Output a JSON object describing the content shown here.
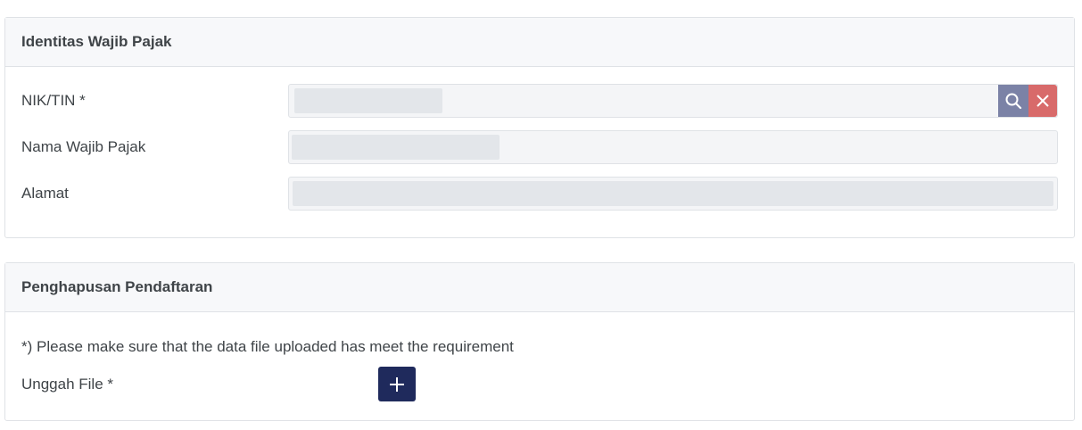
{
  "identity_section": {
    "title": "Identitas Wajib Pajak",
    "fields": {
      "nik": {
        "label": "NIK/TIN *"
      },
      "name": {
        "label": "Nama Wajib Pajak"
      },
      "address": {
        "label": "Alamat"
      }
    }
  },
  "removal_section": {
    "title": "Penghapusan Pendaftaran",
    "note": "*) Please make sure that the data file uploaded has meet the requirement",
    "upload_label": "Unggah File *"
  },
  "icons": {
    "search": "search-icon",
    "clear": "close-icon",
    "add": "plus-icon"
  },
  "colors": {
    "search_button": "#7b82a6",
    "clear_button": "#d86a6a",
    "upload_button": "#1f2a5c",
    "redaction": "#e3e6ea"
  }
}
